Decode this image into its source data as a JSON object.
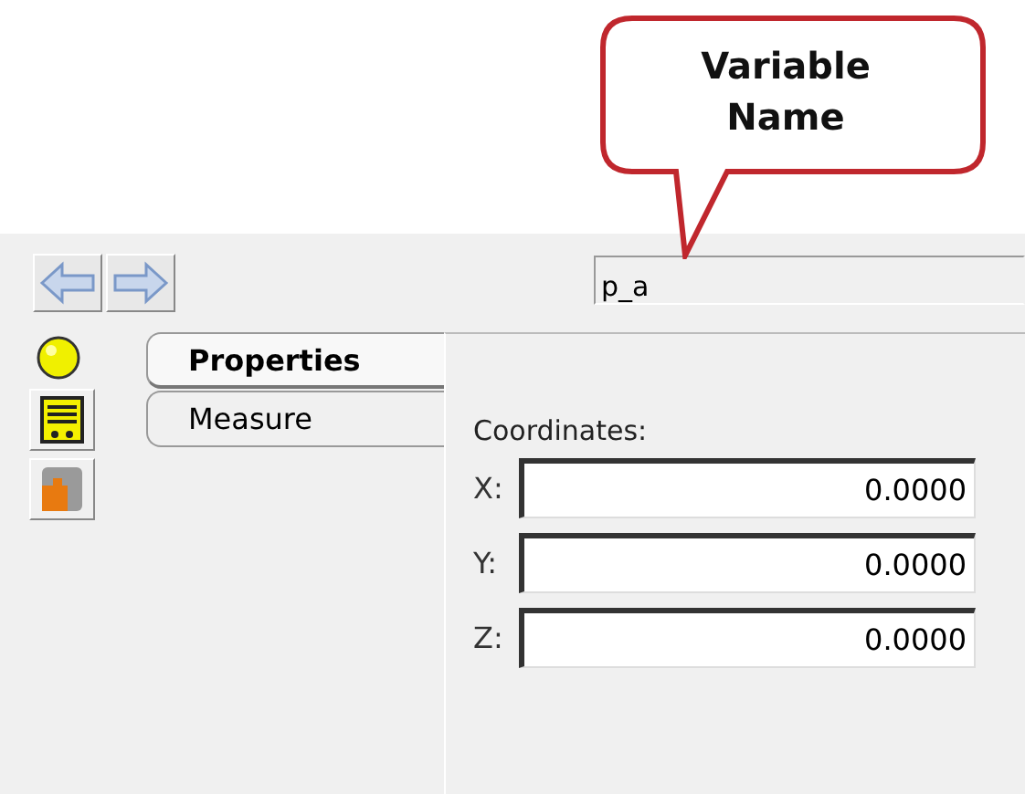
{
  "callout": {
    "text": "Variable Name"
  },
  "variable_field": {
    "value": "p_a"
  },
  "side_icons": [
    {
      "kind": "bulb"
    },
    {
      "kind": "panel"
    },
    {
      "kind": "puzzle"
    }
  ],
  "tabs": [
    {
      "label": "Properties",
      "selected": true
    },
    {
      "label": "Measure",
      "selected": false
    }
  ],
  "coordinates": {
    "label": "Coordinates:",
    "fields": [
      {
        "label": "X:",
        "value": "0.0000"
      },
      {
        "label": "Y:",
        "value": "0.0000"
      },
      {
        "label": "Z:",
        "value": "0.0000"
      }
    ]
  }
}
